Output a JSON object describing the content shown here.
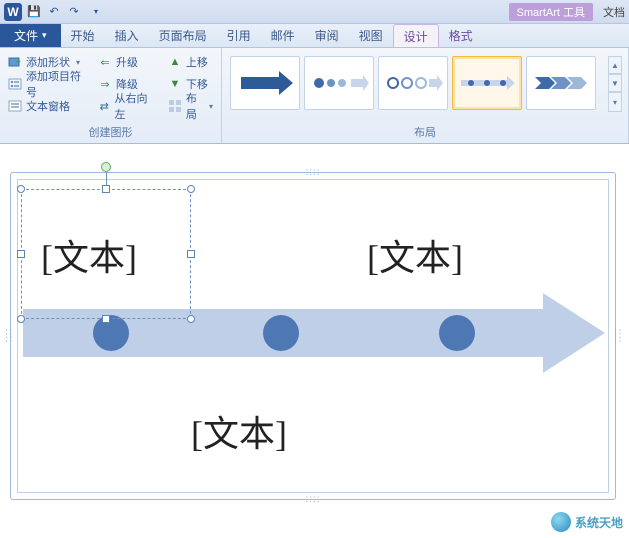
{
  "qat": {
    "app_letter": "W",
    "save": "💾",
    "undo": "↶",
    "redo": "↷"
  },
  "titlebar": {
    "tool_context": "SmartArt 工具",
    "truncated": "文档"
  },
  "tabs": {
    "file": "文件",
    "items": [
      "开始",
      "插入",
      "页面布局",
      "引用",
      "邮件",
      "审阅",
      "视图",
      "设计",
      "格式"
    ],
    "active_index": 7
  },
  "ribbon": {
    "group_create": {
      "label": "创建图形",
      "add_shape": "添加形状",
      "add_bullet": "添加项目符号",
      "text_pane": "文本窗格",
      "promote": "升级",
      "demote": "降级",
      "rtl": "从右向左",
      "move_up": "上移",
      "move_down": "下移",
      "layout_btn": "布局"
    },
    "group_layout": {
      "label": "布局"
    }
  },
  "smartart": {
    "placeholders": [
      "[文本]",
      "[文本]",
      "[文本]"
    ]
  },
  "watermark": {
    "text": "系统天地"
  }
}
